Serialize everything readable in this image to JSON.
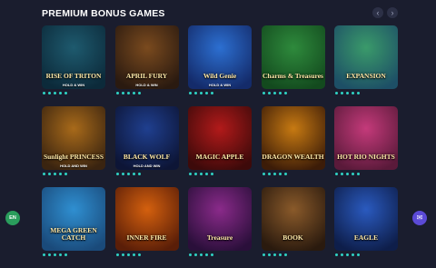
{
  "section": {
    "title": "PREMIUM BONUS GAMES",
    "prev_icon": "chevron-left-icon",
    "next_icon": "chevron-right-icon",
    "prev_glyph": "‹",
    "next_glyph": "›"
  },
  "games": [
    {
      "name": "RISE OF TRITON",
      "sub": "HOLD & WIN",
      "bg": "#1e5a6e",
      "bg2": "#0c2a3a"
    },
    {
      "name": "APRIL FURY",
      "sub": "HOLD & WIN",
      "bg": "#7a4a1e",
      "bg2": "#2a1a10"
    },
    {
      "name": "Wild Genie",
      "sub": "HOLD & WIN",
      "bg": "#2c6fd1",
      "bg2": "#142b6a"
    },
    {
      "name": "Charms & Treasures",
      "sub": "",
      "bg": "#2e8a3c",
      "bg2": "#134a1e"
    },
    {
      "name": "EXPANSION",
      "sub": "",
      "bg": "#3a9a6a",
      "bg2": "#1d4f66"
    },
    {
      "name": "Sunlight PRINCESS",
      "sub": "HOLD AND WIN",
      "bg": "#a86a1a",
      "bg2": "#3a2410"
    },
    {
      "name": "BLACK WOLF",
      "sub": "HOLD AND WIN",
      "bg": "#1f3f8f",
      "bg2": "#0d1536"
    },
    {
      "name": "MAGIC APPLE",
      "sub": "",
      "bg": "#b21a1a",
      "bg2": "#3d0a0a"
    },
    {
      "name": "DRAGON WEALTH",
      "sub": "",
      "bg": "#c77a12",
      "bg2": "#3c1c08"
    },
    {
      "name": "HOT RIO NIGHTS",
      "sub": "",
      "bg": "#c43a7a",
      "bg2": "#5a1a3a"
    },
    {
      "name": "MEGA GREEN CATCH",
      "sub": "",
      "bg": "#2f8fd1",
      "bg2": "#1a4a7a"
    },
    {
      "name": "INNER FIRE",
      "sub": "",
      "bg": "#d4600e",
      "bg2": "#5a1e08"
    },
    {
      "name": "Treasure",
      "sub": "",
      "bg": "#8a2a8a",
      "bg2": "#2a0f3a"
    },
    {
      "name": "BOOK",
      "sub": "",
      "bg": "#8a5a2a",
      "bg2": "#2a1a0e"
    },
    {
      "name": "EAGLE",
      "sub": "",
      "bg": "#2a5abf",
      "bg2": "#0e1e4a"
    }
  ],
  "footer": {
    "language": "EN",
    "chat_icon": "chat-icon",
    "chat_glyph": "✉"
  }
}
